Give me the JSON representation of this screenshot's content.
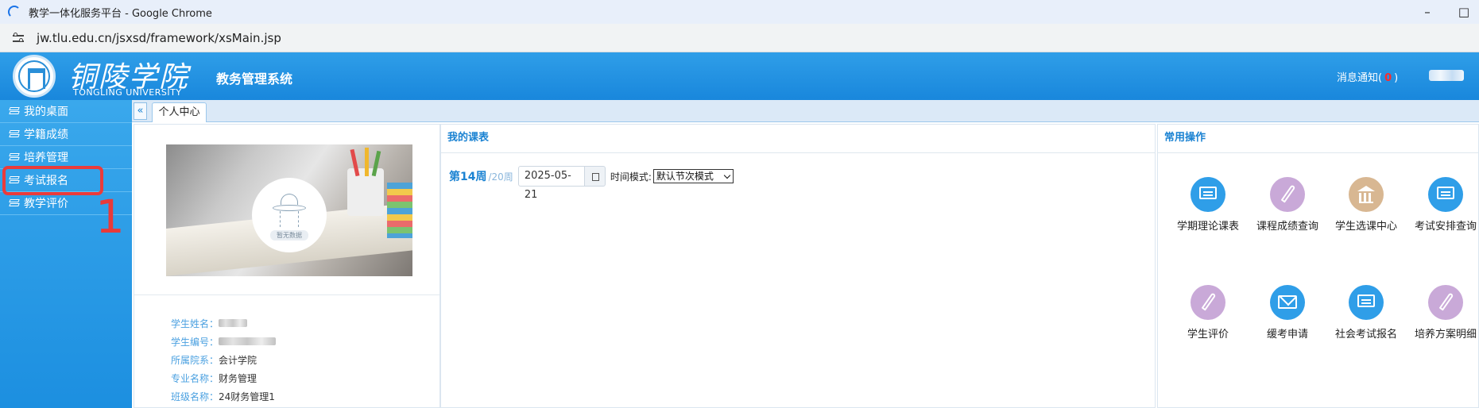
{
  "browser": {
    "window_title": "教学一体化服务平台 - Google Chrome",
    "url": "jw.tlu.edu.cn/jsxsd/framework/xsMain.jsp",
    "minimize": "–",
    "maximize": "□"
  },
  "header": {
    "logo_cn": "铜陵学院",
    "logo_en": "TONGLING UNIVERSITY",
    "system_name": "教务管理系统",
    "notice_prefix": "消息通知(",
    "notice_count": "0",
    "notice_suffix": ")"
  },
  "sidebar": {
    "items": [
      {
        "label": "我的桌面"
      },
      {
        "label": "学籍成绩"
      },
      {
        "label": "培养管理"
      },
      {
        "label": "考试报名"
      },
      {
        "label": "教学评价"
      }
    ],
    "highlight_index": 3,
    "annotation": "1"
  },
  "tabs": {
    "collapse": "«",
    "items": [
      {
        "label": "个人中心"
      }
    ]
  },
  "profile": {
    "no_data_text": "暂无数据",
    "rows": [
      {
        "label": "学生姓名：",
        "value": ""
      },
      {
        "label": "学生编号：",
        "value": ""
      },
      {
        "label": "所属院系：",
        "value": "会计学院"
      },
      {
        "label": "专业名称：",
        "value": "财务管理"
      },
      {
        "label": "班级名称：",
        "value": "24财务管理1"
      }
    ]
  },
  "schedule": {
    "title": "我的课表",
    "current_week": "第14周",
    "total_weeks": "/20周",
    "date": "2025-05-21",
    "mode_label": "时间模式:",
    "mode_selected": "默认节次模式"
  },
  "operations": {
    "title": "常用操作",
    "items": [
      {
        "label": "学期理论课表",
        "icon": "chat-icon",
        "color": "#2f9ee8"
      },
      {
        "label": "课程成绩查询",
        "icon": "quill-icon",
        "color": "#c9a9d8"
      },
      {
        "label": "学生选课中心",
        "icon": "bank-icon",
        "color": "#d8b792"
      },
      {
        "label": "考试安排查询",
        "icon": "chat-icon",
        "color": "#2f9ee8"
      },
      {
        "label": "学生评价",
        "icon": "quill-icon",
        "color": "#c9a9d8"
      },
      {
        "label": "缓考申请",
        "icon": "mail-icon",
        "color": "#2f9ee8"
      },
      {
        "label": "社会考试报名",
        "icon": "chat-icon",
        "color": "#2f9ee8"
      },
      {
        "label": "培养方案明细",
        "icon": "quill-icon",
        "color": "#c9a9d8"
      }
    ]
  },
  "colors": {
    "accent": "#1a82d2",
    "header": "#2f9ee8",
    "highlight": "#ea3b3b"
  }
}
